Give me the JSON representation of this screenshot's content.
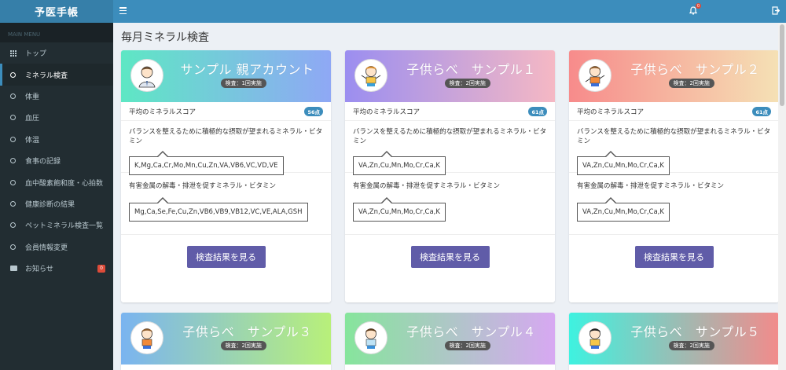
{
  "app": {
    "title": "予医手帳"
  },
  "sidebar": {
    "header": "MAIN MENU",
    "items": [
      {
        "label": "トップ",
        "icon": "grid-icon"
      },
      {
        "label": "ミネラル検査",
        "icon": "circle-icon",
        "active": true
      },
      {
        "label": "体重",
        "icon": "circle-icon"
      },
      {
        "label": "血圧",
        "icon": "circle-icon"
      },
      {
        "label": "体温",
        "icon": "circle-icon"
      },
      {
        "label": "食事の記録",
        "icon": "circle-icon"
      },
      {
        "label": "血中酸素飽和度・心拍数",
        "icon": "circle-icon"
      },
      {
        "label": "健康診断の結果",
        "icon": "circle-icon"
      },
      {
        "label": "ペットミネラル検査一覧",
        "icon": "circle-icon"
      },
      {
        "label": "会員情報変更",
        "icon": "circle-icon"
      },
      {
        "label": "お知らせ",
        "icon": "envelope-icon",
        "badge": "0"
      }
    ]
  },
  "navbar": {
    "notification_count": "0"
  },
  "main": {
    "title": "毎月ミネラル検査",
    "cards": [
      {
        "name": "サンプル 親アカウント",
        "count": "検査：1回実施",
        "score_label": "平均のミネラルスコア",
        "score": "56点",
        "recommend_label": "バランスを整えるために積極的な摂取が望まれるミネラル・ビタミン",
        "recommend_value": "K,Mg,Ca,Cr,Mo,Mn,Cu,Zn,VA,VB6,VC,VD,VE",
        "detox_label": "有害金属の解毒・排泄を促すミネラル・ビタミン",
        "detox_value": "Mg,Ca,Se,Fe,Cu,Zn,VB6,VB9,VB12,VC,VE,ALA,GSH",
        "button": "検査結果を見る",
        "gradient": [
          "#5ee7c4",
          "#8fa8f5"
        ]
      },
      {
        "name": "子供らべ　サンプル１",
        "count": "検査：2回実施",
        "score_label": "平均のミネラルスコア",
        "score": "61点",
        "recommend_label": "バランスを整えるために積極的な摂取が望まれるミネラル・ビタミン",
        "recommend_value": "VA,Zn,Cu,Mn,Mo,Cr,Ca,K",
        "detox_label": "有害金属の解毒・排泄を促すミネラル・ビタミン",
        "detox_value": "VA,Zn,Cu,Mn,Mo,Cr,Ca,K",
        "button": "検査結果を見る",
        "gradient": [
          "#9b8ef0",
          "#f5b8c4"
        ]
      },
      {
        "name": "子供らべ　サンプル２",
        "count": "検査：2回実施",
        "score_label": "平均のミネラルスコア",
        "score": "61点",
        "recommend_label": "バランスを整えるために積極的な摂取が望まれるミネラル・ビタミン",
        "recommend_value": "VA,Zn,Cu,Mn,Mo,Cr,Ca,K",
        "detox_label": "有害金属の解毒・排泄を促すミネラル・ビタミン",
        "detox_value": "VA,Zn,Cu,Mn,Mo,Cr,Ca,K",
        "button": "検査結果を見る",
        "gradient": [
          "#f78b8b",
          "#f5e1b5"
        ]
      },
      {
        "name": "子供らべ　サンプル３",
        "count": "検査：2回実施",
        "gradient": [
          "#7ab4f0",
          "#b8f07a"
        ]
      },
      {
        "name": "子供らべ　サンプル４",
        "count": "検査：2回実施",
        "gradient": [
          "#86e59c",
          "#d7a8f2"
        ]
      },
      {
        "name": "子供らべ　サンプル５",
        "count": "検査：2回実施",
        "gradient": [
          "#3ef2e0",
          "#f28b8b"
        ]
      }
    ]
  }
}
